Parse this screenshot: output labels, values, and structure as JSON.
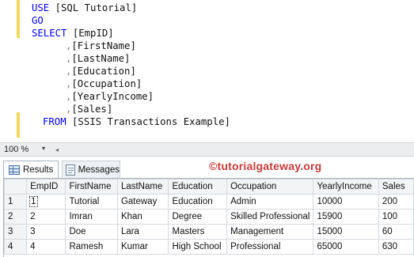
{
  "editor": {
    "lines": {
      "use_kw": "USE",
      "use_db": "[SQL Tutorial]",
      "go": "GO",
      "select_kw": "SELECT",
      "col1": "[EmpID]",
      "col2_comma": ",",
      "col2": "[FirstName]",
      "col3_comma": ",",
      "col3": "[LastName]",
      "col4_comma": ",",
      "col4": "[Education]",
      "col5_comma": ",",
      "col5": "[Occupation]",
      "col6_comma": ",",
      "col6": "[YearlyIncome]",
      "col7_comma": ",",
      "col7": "[Sales]",
      "from_kw": "FROM",
      "from_table": "[SSIS Transactions Example]"
    }
  },
  "zoom": {
    "value": "100 %",
    "arrow": "▾",
    "scroll_left": "◂"
  },
  "tabs": {
    "results": "Results",
    "messages": "Messages",
    "results_icon": "grid-icon",
    "messages_icon": "messages-icon"
  },
  "watermark": "©tutorialgateway.org",
  "grid": {
    "columns": [
      "EmpID",
      "FirstName",
      "LastName",
      "Education",
      "Occupation",
      "YearlyIncome",
      "Sales"
    ],
    "rows": [
      {
        "num": "1",
        "EmpID": "1",
        "FirstName": "Tutorial",
        "LastName": "Gateway",
        "Education": "Education",
        "Occupation": "Admin",
        "YearlyIncome": "10000",
        "Sales": "200"
      },
      {
        "num": "2",
        "EmpID": "2",
        "FirstName": "Imran",
        "LastName": "Khan",
        "Education": "Degree",
        "Occupation": "Skilled Professional",
        "YearlyIncome": "15900",
        "Sales": "100"
      },
      {
        "num": "3",
        "EmpID": "3",
        "FirstName": "Doe",
        "LastName": "Lara",
        "Education": "Masters",
        "Occupation": "Management",
        "YearlyIncome": "15000",
        "Sales": "60"
      },
      {
        "num": "4",
        "EmpID": "4",
        "FirstName": "Ramesh",
        "LastName": "Kumar",
        "Education": "High School",
        "Occupation": "Professional",
        "YearlyIncome": "65000",
        "Sales": "630"
      }
    ]
  }
}
